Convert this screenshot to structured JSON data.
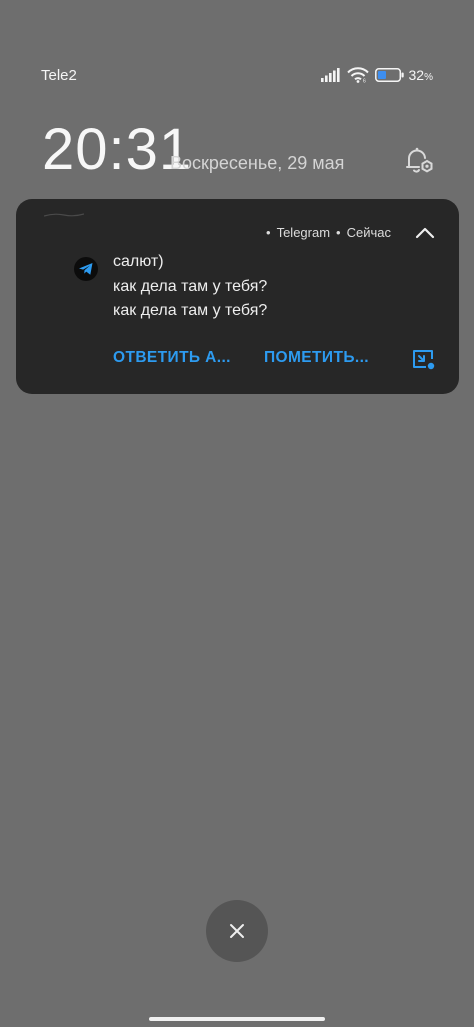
{
  "status_bar": {
    "carrier": "Tele2",
    "battery_percent": "32",
    "battery_unit": "%",
    "icons": [
      "signal-icon",
      "wifi-icon",
      "battery-icon"
    ]
  },
  "lockscreen": {
    "time": "20:31",
    "date": "Воскресенье, 29 мая"
  },
  "notification": {
    "app_name": "Telegram",
    "time_label": "Сейчас",
    "messages": [
      "салют)",
      "как дела там у тебя?",
      "как дела там у тебя?"
    ],
    "actions": {
      "reply": "ОТВЕТИТЬ А...",
      "mark": "ПОМЕТИТЬ..."
    },
    "icons": [
      "telegram-icon",
      "chevron-up-icon",
      "picture-in-picture-icon"
    ]
  },
  "colors": {
    "background": "#6e6e6e",
    "card": "#272727",
    "accent": "#2d9bf0"
  }
}
